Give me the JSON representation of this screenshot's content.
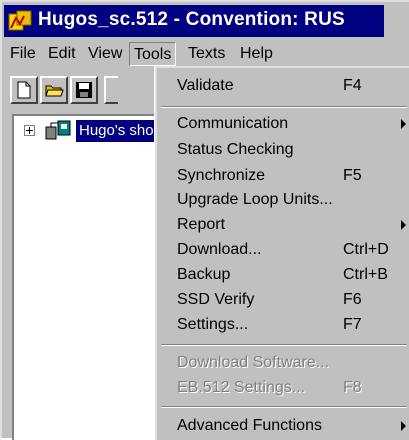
{
  "window": {
    "title": "Hugos_sc.512 - Convention: RUS",
    "title_bar_color": "#000080"
  },
  "menubar": {
    "file": "File",
    "edit": "Edit",
    "view": "View",
    "tools": "Tools",
    "texts": "Texts",
    "help": "Help"
  },
  "toolbar": {
    "buttons": [
      "new-document-icon",
      "open-folder-icon",
      "save-disk-icon"
    ]
  },
  "tree": {
    "root_label": "Hugo's sho",
    "selection_color": "#000080"
  },
  "tools_menu": {
    "validate": {
      "label": "Validate",
      "shortcut": "F4"
    },
    "communication": {
      "label": "Communication"
    },
    "status_checking": {
      "label": "Status Checking"
    },
    "synchronize": {
      "label": "Synchronize",
      "shortcut": "F5"
    },
    "upgrade_loop_units": {
      "label": "Upgrade Loop Units..."
    },
    "report": {
      "label": "Report"
    },
    "download": {
      "label": "Download...",
      "shortcut": "Ctrl+D"
    },
    "backup": {
      "label": "Backup",
      "shortcut": "Ctrl+B"
    },
    "ssd_verify": {
      "label": "SSD Verify",
      "shortcut": "F6"
    },
    "settings": {
      "label": "Settings...",
      "shortcut": "F7"
    },
    "download_software": {
      "label": "Download Software..."
    },
    "eb512_settings": {
      "label": "EB.512 Settings...",
      "shortcut": "F8"
    },
    "advanced_functions": {
      "label": "Advanced Functions"
    }
  }
}
